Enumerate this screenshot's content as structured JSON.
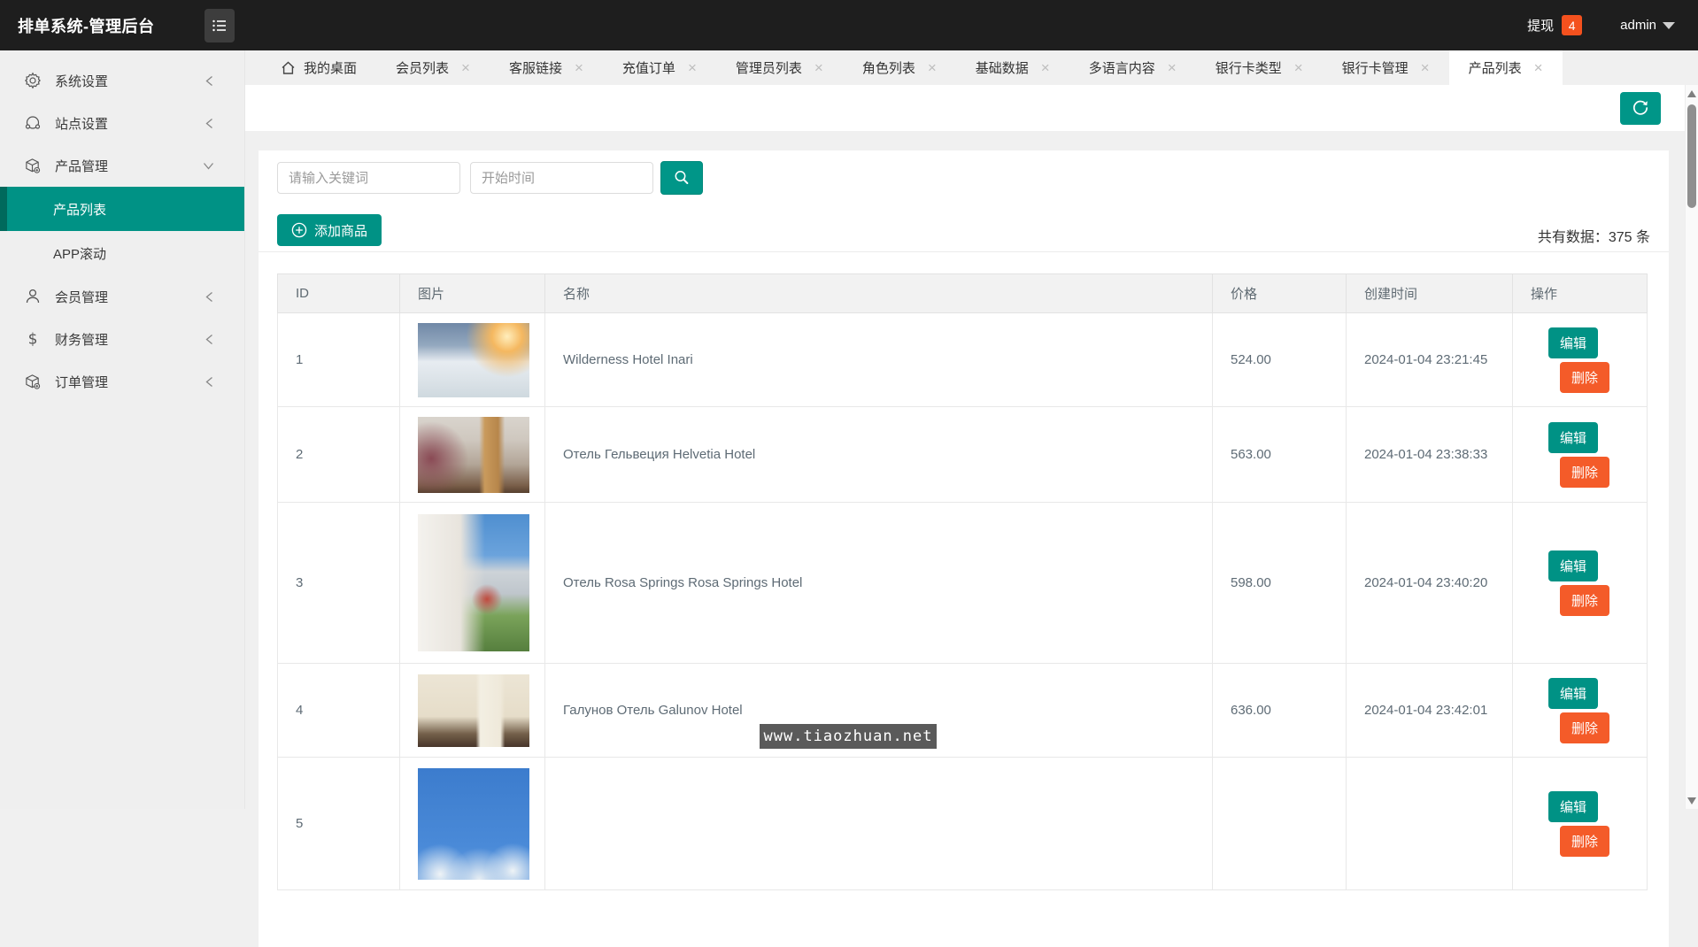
{
  "header": {
    "title": "排单系统-管理后台",
    "withdraw_label": "提现",
    "withdraw_badge": "4",
    "user": "admin"
  },
  "tabs": [
    {
      "label": "我的桌面",
      "closable": false,
      "active": false,
      "home": true
    },
    {
      "label": "会员列表",
      "closable": true,
      "active": false
    },
    {
      "label": "客服链接",
      "closable": true,
      "active": false
    },
    {
      "label": "充值订单",
      "closable": true,
      "active": false
    },
    {
      "label": "管理员列表",
      "closable": true,
      "active": false
    },
    {
      "label": "角色列表",
      "closable": true,
      "active": false
    },
    {
      "label": "基础数据",
      "closable": true,
      "active": false
    },
    {
      "label": "多语言内容",
      "closable": true,
      "active": false
    },
    {
      "label": "银行卡类型",
      "closable": true,
      "active": false
    },
    {
      "label": "银行卡管理",
      "closable": true,
      "active": false
    },
    {
      "label": "产品列表",
      "closable": true,
      "active": true
    }
  ],
  "sidebar": [
    {
      "label": "系统设置",
      "icon": "gear-icon",
      "state": "collapsed"
    },
    {
      "label": "站点设置",
      "icon": "site-icon",
      "state": "collapsed"
    },
    {
      "label": "产品管理",
      "icon": "box-icon",
      "state": "expanded",
      "children": [
        {
          "label": "产品列表",
          "active": true
        },
        {
          "label": "APP滚动",
          "active": false
        }
      ]
    },
    {
      "label": "会员管理",
      "icon": "user-icon",
      "state": "collapsed"
    },
    {
      "label": "财务管理",
      "icon": "dollar-icon",
      "state": "collapsed"
    },
    {
      "label": "订单管理",
      "icon": "box-icon",
      "state": "collapsed"
    }
  ],
  "toolbar": {
    "search_placeholder": "请输入关键词",
    "date_placeholder": "开始时间",
    "add_button": "添加商品",
    "total_text": "共有数据：375 条"
  },
  "table": {
    "columns": [
      "ID",
      "图片",
      "名称",
      "价格",
      "创建时间",
      "操作"
    ],
    "actions": {
      "edit": "编辑",
      "delete": "删除"
    },
    "rows": [
      {
        "id": "1",
        "name": "Wilderness Hotel Inari",
        "price": "524.00",
        "created": "2024-01-04 23:21:45",
        "img": "img1"
      },
      {
        "id": "2",
        "name": "Отель Гельвеция Helvetia Hotel",
        "price": "563.00",
        "created": "2024-01-04 23:38:33",
        "img": "img2"
      },
      {
        "id": "3",
        "name": "Отель Rosa Springs Rosa Springs Hotel",
        "price": "598.00",
        "created": "2024-01-04 23:40:20",
        "img": "img3"
      },
      {
        "id": "4",
        "name": "Галунов Отель Galunov Hotel",
        "price": "636.00",
        "created": "2024-01-04 23:42:01",
        "img": "img4"
      },
      {
        "id": "5",
        "name": "",
        "price": "",
        "created": "",
        "img": "img5"
      }
    ]
  },
  "watermark": "www.tiaozhuan.net",
  "colors": {
    "accent": "#009285",
    "danger": "#f45b29",
    "badge": "#f4511e",
    "header_bg": "#1e1e1e"
  }
}
